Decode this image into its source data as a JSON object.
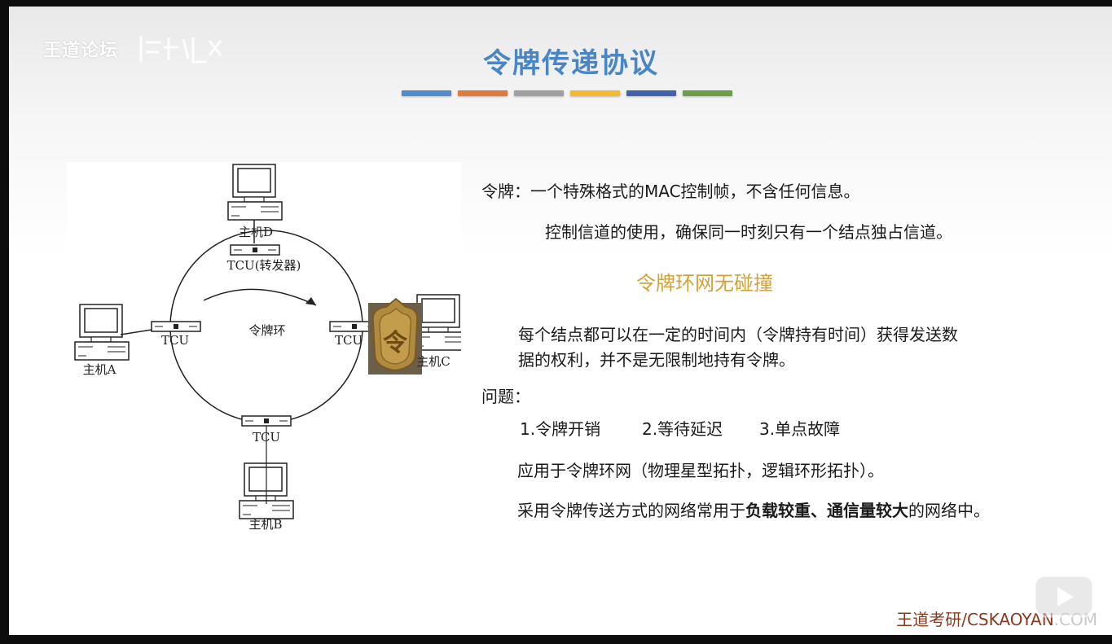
{
  "watermark": {
    "text": "王道论坛"
  },
  "slide": {
    "title": "令牌传递协议",
    "underline_colors": [
      "#4f8ccc",
      "#e07a3c",
      "#a0a0a0",
      "#f2b935",
      "#3e64ad",
      "#6c9f45"
    ]
  },
  "diagram": {
    "host_d": "主机D",
    "host_a": "主机A",
    "host_b": "主机B",
    "host_c": "主机C",
    "tcu_top": "TCU(转发器)",
    "tcu_left": "TCU",
    "tcu_right": "TCU",
    "tcu_bottom": "TCU",
    "ring_label": "令牌环",
    "token_glyph": "令"
  },
  "content": {
    "token_def": "令牌：一个特殊格式的MAC控制帧，不含任何信息。",
    "channel_control": "控制信道的使用，确保同一时刻只有一个结点独占信道。",
    "no_collision": "令牌环网无碰撞",
    "hold_line1": "每个结点都可以在一定的时间内（令牌持有时间）获得发送数",
    "hold_line2": "据的权利，并不是无限制地持有令牌。",
    "problems_label": "问题：",
    "problem_1": "1.令牌开销",
    "problem_2": "2.等待延迟",
    "problem_3": "3.单点故障",
    "application": "应用于令牌环网（物理星型拓扑，逻辑环形拓扑）。",
    "usage_prefix": "采用令牌传送方式的网络常用于",
    "usage_bold": "负载较重、通信量较大",
    "usage_suffix": "的网络中。"
  },
  "footer": {
    "brand_main": "王道考研/CSKAOYAN",
    "brand_faded": ".COM"
  },
  "icons": {
    "player_logo": "bilibili-tv-icon",
    "token_badge": "token-badge-icon"
  }
}
